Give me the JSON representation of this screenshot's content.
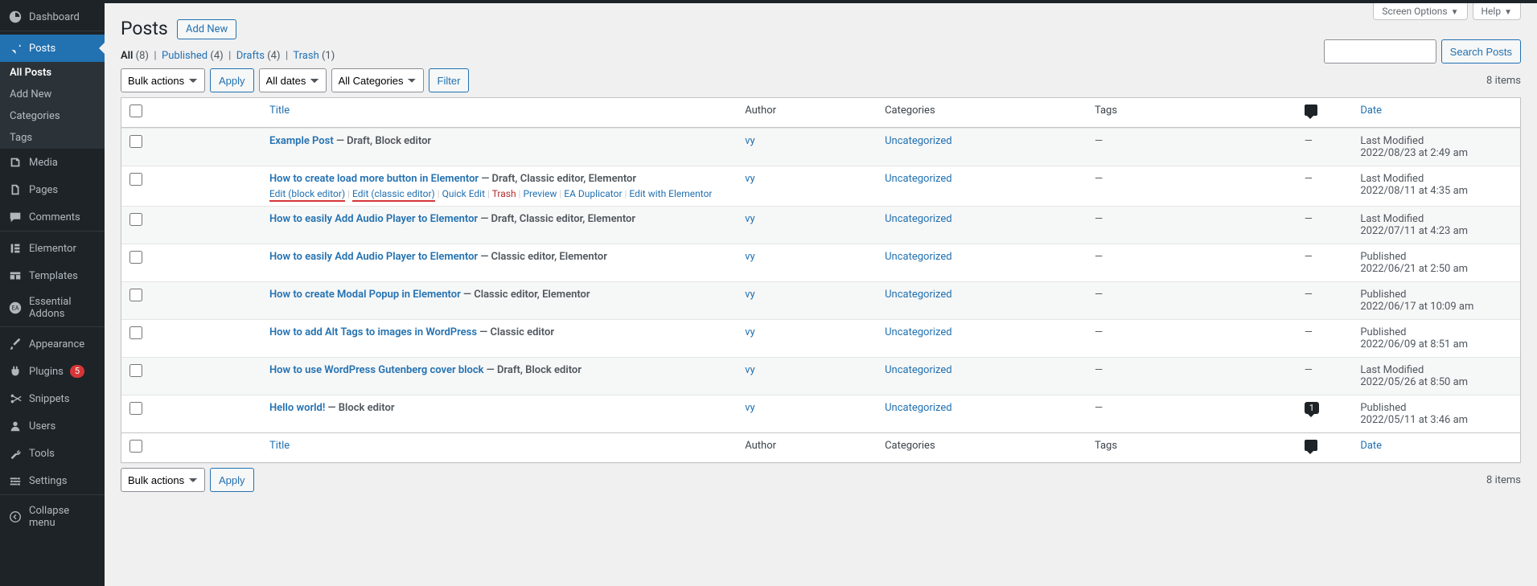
{
  "screen_meta": {
    "screen_options": "Screen Options",
    "help": "Help"
  },
  "sidebar": {
    "dashboard": "Dashboard",
    "posts": "Posts",
    "posts_sub": {
      "all": "All Posts",
      "add": "Add New",
      "cats": "Categories",
      "tags": "Tags"
    },
    "media": "Media",
    "pages": "Pages",
    "comments": "Comments",
    "elementor": "Elementor",
    "templates": "Templates",
    "essential_addons": "Essential Addons",
    "appearance": "Appearance",
    "plugins": "Plugins",
    "plugins_badge": "5",
    "snippets": "Snippets",
    "users": "Users",
    "tools": "Tools",
    "settings": "Settings",
    "collapse": "Collapse menu"
  },
  "page": {
    "title": "Posts",
    "add_new": "Add New"
  },
  "views": {
    "all_label": "All",
    "all_count": "(8)",
    "published_label": "Published",
    "published_count": "(4)",
    "drafts_label": "Drafts",
    "drafts_count": "(4)",
    "trash_label": "Trash",
    "trash_count": "(1)"
  },
  "filters": {
    "bulk": "Bulk actions",
    "apply": "Apply",
    "dates": "All dates",
    "cats": "All Categories",
    "filter": "Filter",
    "items": "8 items"
  },
  "search": {
    "button": "Search Posts"
  },
  "columns": {
    "title": "Title",
    "author": "Author",
    "categories": "Categories",
    "tags": "Tags",
    "date": "Date"
  },
  "row_actions": {
    "edit_block": "Edit (block editor)",
    "edit_classic": "Edit (classic editor)",
    "quick": "Quick Edit",
    "trash": "Trash",
    "preview": "Preview",
    "ea": "EA Duplicator",
    "elementor": "Edit with Elementor"
  },
  "posts": [
    {
      "title": "Example Post",
      "state": "— Draft, Block editor",
      "author": "vy",
      "cat": "Uncategorized",
      "tags": "—",
      "comments": "—",
      "date_lbl": "Last Modified",
      "date_val": "2022/08/23 at 2:49 am",
      "show_actions": false
    },
    {
      "title": "How to create load more button in Elementor",
      "state": "— Draft, Classic editor, Elementor",
      "author": "vy",
      "cat": "Uncategorized",
      "tags": "—",
      "comments": "—",
      "date_lbl": "Last Modified",
      "date_val": "2022/08/11 at 4:35 am",
      "show_actions": true
    },
    {
      "title": "How to easily Add Audio Player to Elementor",
      "state": "— Draft, Classic editor, Elementor",
      "author": "vy",
      "cat": "Uncategorized",
      "tags": "—",
      "comments": "—",
      "date_lbl": "Last Modified",
      "date_val": "2022/07/11 at 4:23 am",
      "show_actions": false
    },
    {
      "title": "How to easily Add Audio Player to Elementor",
      "state": "— Classic editor, Elementor",
      "author": "vy",
      "cat": "Uncategorized",
      "tags": "—",
      "comments": "—",
      "date_lbl": "Published",
      "date_val": "2022/06/21 at 2:50 am",
      "show_actions": false
    },
    {
      "title": "How to create Modal Popup in Elementor",
      "state": "— Classic editor, Elementor",
      "author": "vy",
      "cat": "Uncategorized",
      "tags": "—",
      "comments": "—",
      "date_lbl": "Published",
      "date_val": "2022/06/17 at 10:09 am",
      "show_actions": false
    },
    {
      "title": "How to add Alt Tags to images in WordPress",
      "state": "— Classic editor",
      "author": "vy",
      "cat": "Uncategorized",
      "tags": "—",
      "comments": "—",
      "date_lbl": "Published",
      "date_val": "2022/06/09 at 8:51 am",
      "show_actions": false
    },
    {
      "title": "How to use WordPress Gutenberg cover block",
      "state": "— Draft, Block editor",
      "author": "vy",
      "cat": "Uncategorized",
      "tags": "—",
      "comments": "—",
      "date_lbl": "Last Modified",
      "date_val": "2022/05/26 at 8:50 am",
      "show_actions": false
    },
    {
      "title": "Hello world!",
      "state": "— Block editor",
      "author": "vy",
      "cat": "Uncategorized",
      "tags": "—",
      "comments": "1",
      "date_lbl": "Published",
      "date_val": "2022/05/11 at 3:46 am",
      "show_actions": false
    }
  ]
}
